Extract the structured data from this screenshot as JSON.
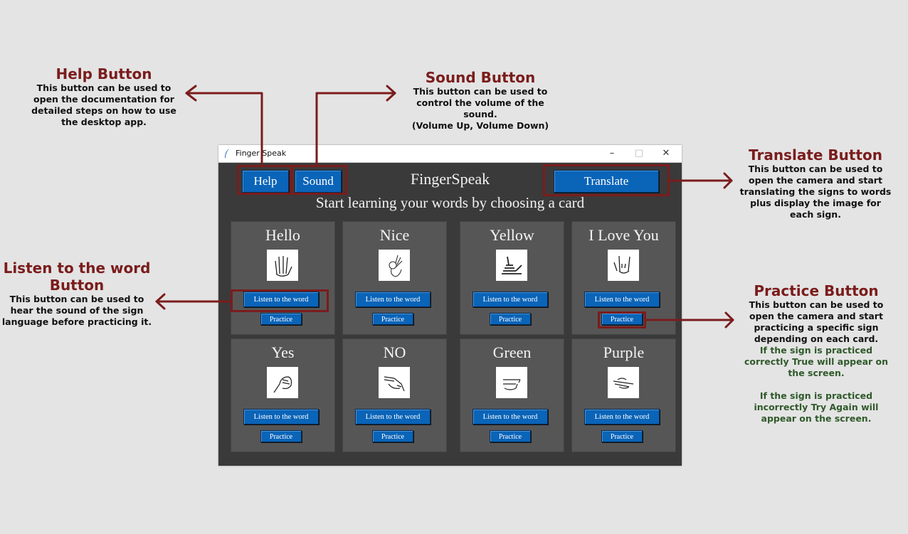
{
  "annotations": {
    "help": {
      "title": "Help Button",
      "desc": "This button can be used to open the documentation for detailed steps on how to use the desktop app."
    },
    "sound": {
      "title": "Sound Button",
      "desc": "This button can be used to control the volume of the sound.",
      "desc2": "(Volume Up, Volume Down)"
    },
    "translate": {
      "title": "Translate Button",
      "desc": "This button can be used to open the camera and start translating the signs to words plus display the image for each sign."
    },
    "listen": {
      "title": "Listen to the word Button",
      "desc": "This button can be used to hear the sound of the sign language before practicing it."
    },
    "practice": {
      "title": "Practice Button",
      "desc": "This button can be used to open the camera and start practicing a specific sign depending on each card.",
      "note1": "If the sign is practiced correctly True will appear on the screen.",
      "note2": "If the sign is practiced incorrectly Try Again will appear on the screen."
    }
  },
  "window": {
    "title": "Finger Speak",
    "controls": {
      "minimize": "–",
      "maximize": "□",
      "close": "✕"
    }
  },
  "app": {
    "title": "FingerSpeak",
    "subtitle": "Start learning your words by choosing a card",
    "help_label": "Help",
    "sound_label": "Sound",
    "translate_label": "Translate"
  },
  "cards": [
    {
      "word": "Hello",
      "listen": "Listen to the word",
      "practice": "Practice",
      "icon": "open-hand-icon"
    },
    {
      "word": "Nice",
      "listen": "Listen to the word",
      "practice": "Practice",
      "icon": "ok-hand-icon"
    },
    {
      "word": "Yellow",
      "listen": "Listen to the word",
      "practice": "Practice",
      "icon": "y-hand-icon"
    },
    {
      "word": "I Love You",
      "listen": "Listen to the word",
      "practice": "Practice",
      "icon": "ily-hand-icon"
    },
    {
      "word": "Yes",
      "listen": "Listen to the word",
      "practice": "Practice",
      "icon": "fist-hand-icon"
    },
    {
      "word": "NO",
      "listen": "Listen to the word",
      "practice": "Practice",
      "icon": "no-hand-icon"
    },
    {
      "word": "Green",
      "listen": "Listen to the word",
      "practice": "Practice",
      "icon": "g-hand-icon"
    },
    {
      "word": "Purple",
      "listen": "Listen to the word",
      "practice": "Practice",
      "icon": "p-hand-icon"
    }
  ],
  "colors": {
    "accent": "#7b1c1c",
    "note": "#2f5a2a",
    "button": "#0a64b8",
    "window_bg": "#3a3a3a",
    "card_bg": "#565656"
  }
}
